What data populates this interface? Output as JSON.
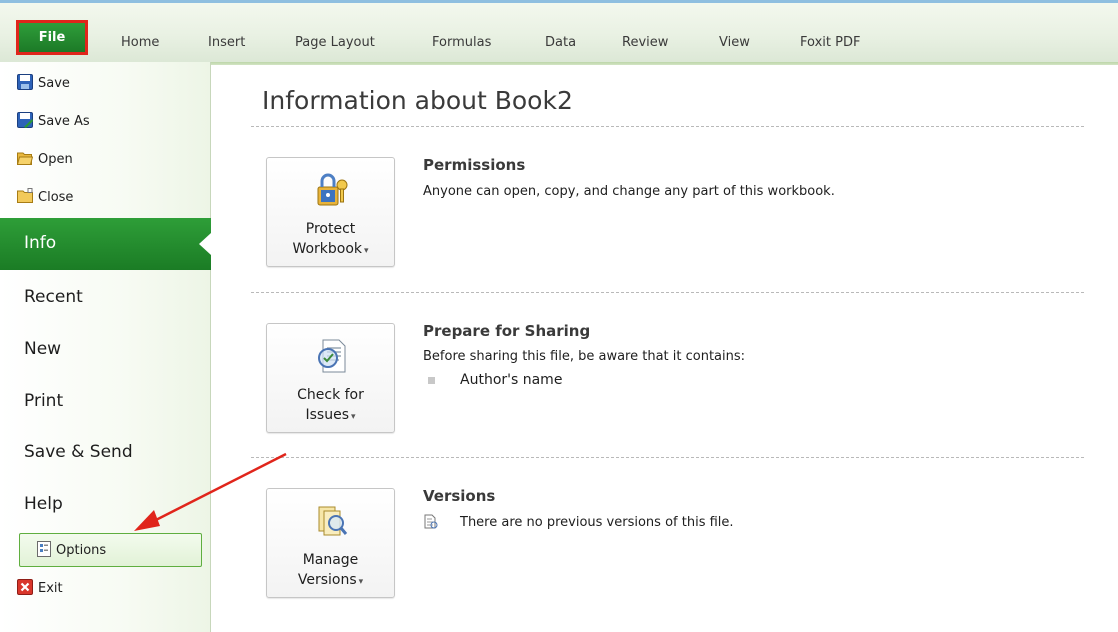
{
  "ribbon": {
    "file_tab": "File",
    "tabs": [
      "Home",
      "Insert",
      "Page Layout",
      "Formulas",
      "Data",
      "Review",
      "View",
      "Foxit PDF"
    ]
  },
  "leftnav": {
    "commands": [
      {
        "label": "Save",
        "icon": "save-icon"
      },
      {
        "label": "Save As",
        "icon": "save-as-icon"
      },
      {
        "label": "Open",
        "icon": "open-folder-icon"
      },
      {
        "label": "Close",
        "icon": "close-folder-icon"
      }
    ],
    "selected": "Info",
    "items": [
      "Recent",
      "New",
      "Print",
      "Save & Send",
      "Help"
    ],
    "options_label": "Options",
    "exit_label": "Exit"
  },
  "main": {
    "title": "Information about Book2",
    "sections": [
      {
        "button_line1": "Protect",
        "button_line2": "Workbook",
        "heading": "Permissions",
        "text": "Anyone can open, copy, and change any part of this workbook."
      },
      {
        "button_line1": "Check for",
        "button_line2": "Issues",
        "heading": "Prepare for Sharing",
        "text": "Before sharing this file, be aware that it contains:",
        "bullets": [
          "Author's name"
        ]
      },
      {
        "button_line1": "Manage",
        "button_line2": "Versions",
        "heading": "Versions",
        "text": "There are no previous versions of this file."
      }
    ]
  },
  "colors": {
    "accent_green": "#1f7f29",
    "highlight_red": "#e0251b"
  }
}
